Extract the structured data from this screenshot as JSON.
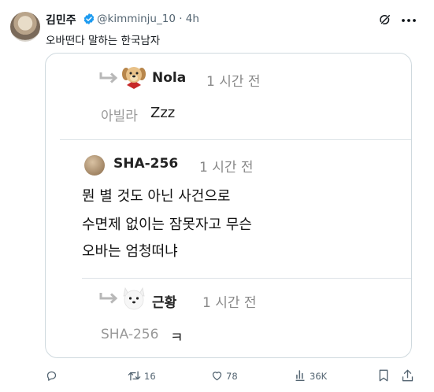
{
  "tweet": {
    "author_name": "김민주",
    "handle": "@kimminju_10 · 4h",
    "text": "오바떤다 말하는 한국남자"
  },
  "comments": [
    {
      "name": "Nola",
      "time": "1 시간 전",
      "mention": "아빌라",
      "text": "Zzz",
      "is_reply": true
    },
    {
      "name": "SHA-256",
      "time": "1 시간 전",
      "lines": [
        "뭔 별 것도 아닌 사건으로",
        "수면제 없이는 잠못자고 무슨",
        "오바는 엄청떠냐"
      ],
      "is_reply": false
    },
    {
      "name": "근황",
      "time": "1 시간 전",
      "mention": "SHA-256",
      "text": "ㅋ",
      "is_reply": true
    }
  ],
  "actions": {
    "replies": "",
    "retweets": "16",
    "likes": "78",
    "views": "36K"
  },
  "colors": {
    "text": "#0f1419",
    "secondary": "#536471",
    "verified": "#1d9bf0",
    "border": "#cfd9de"
  }
}
